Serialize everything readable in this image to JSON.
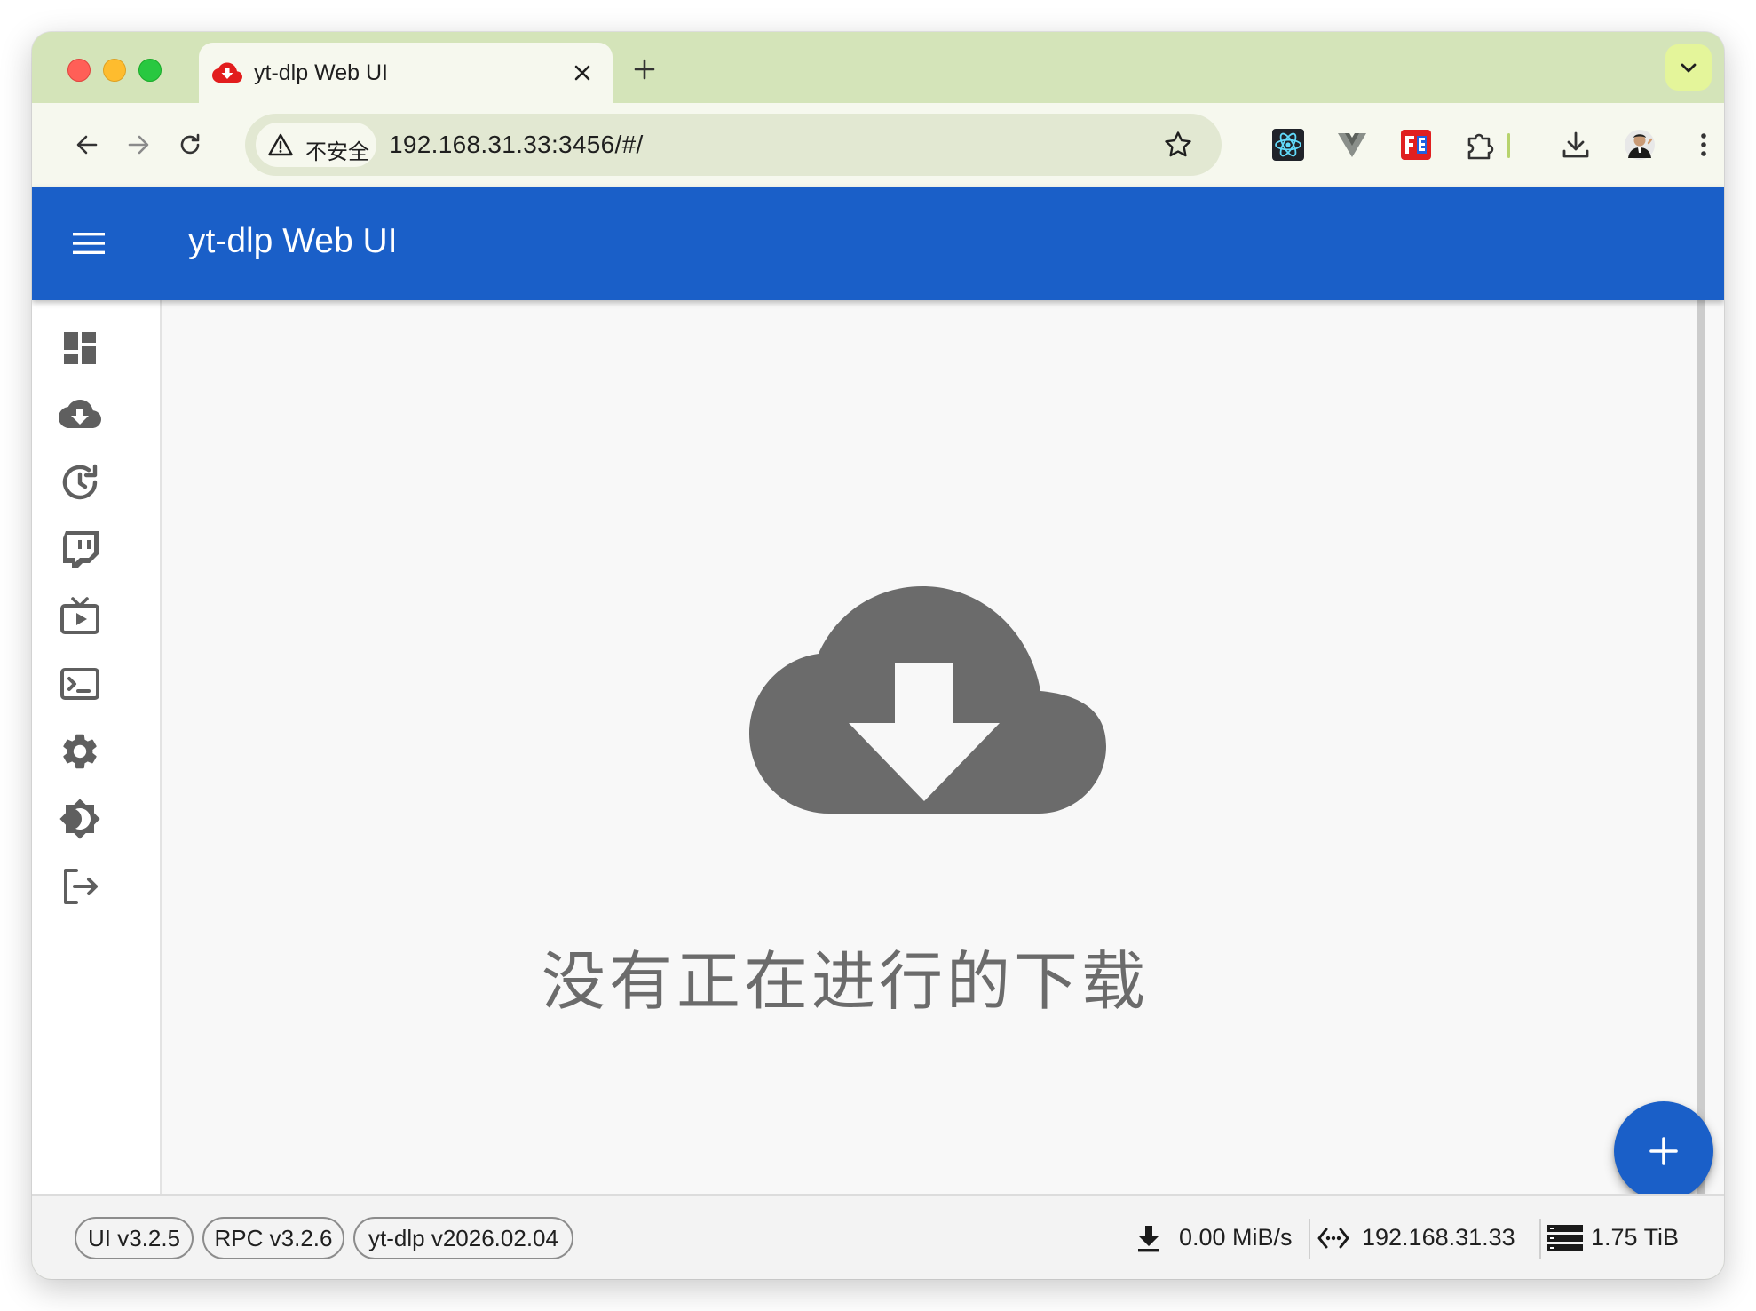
{
  "browser": {
    "tab_title": "yt-dlp Web UI",
    "security_chip": "不安全",
    "url": "192.168.31.33:3456/#/"
  },
  "app": {
    "title": "yt-dlp Web UI",
    "accent_color": "#1a5fc8"
  },
  "sidebar": {
    "items": [
      {
        "icon": "dashboard-icon"
      },
      {
        "icon": "cloud-download-icon"
      },
      {
        "icon": "history-icon"
      },
      {
        "icon": "twitch-icon"
      },
      {
        "icon": "tv-play-icon"
      },
      {
        "icon": "terminal-icon"
      },
      {
        "icon": "settings-icon"
      },
      {
        "icon": "theme-toggle-icon"
      },
      {
        "icon": "logout-icon"
      }
    ]
  },
  "main": {
    "empty_message": "没有正在进行的下载"
  },
  "footer": {
    "versions": [
      "UI v3.2.5",
      "RPC v3.2.6",
      "yt-dlp v2026.02.04"
    ],
    "download_speed": "0.00 MiB/s",
    "server_address": "192.168.31.33",
    "free_space": "1.75 TiB"
  }
}
